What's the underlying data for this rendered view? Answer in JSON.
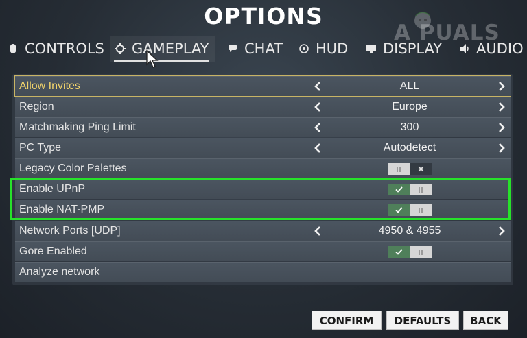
{
  "header": {
    "title": "OPTIONS",
    "watermark": "A  PUALS"
  },
  "tabs": [
    {
      "label": "CONTROLS",
      "icon": "controller-icon",
      "active": false
    },
    {
      "label": "GAMEPLAY",
      "icon": "gear-icon",
      "active": true
    },
    {
      "label": "CHAT",
      "icon": "chat-bubble-icon",
      "active": false
    },
    {
      "label": "HUD",
      "icon": "target-icon",
      "active": false
    },
    {
      "label": "DISPLAY",
      "icon": "monitor-icon",
      "active": false
    },
    {
      "label": "AUDIO",
      "icon": "speaker-icon",
      "active": false
    }
  ],
  "settings": [
    {
      "label": "Allow Invites",
      "type": "select",
      "value": "ALL"
    },
    {
      "label": "Region",
      "type": "select",
      "value": "Europe"
    },
    {
      "label": "Matchmaking Ping Limit",
      "type": "select",
      "value": "300"
    },
    {
      "label": "PC Type",
      "type": "select",
      "value": "Autodetect"
    },
    {
      "label": "Legacy Color Palettes",
      "type": "toggle",
      "on": false
    },
    {
      "label": "Enable UPnP",
      "type": "toggle",
      "on": true
    },
    {
      "label": "Enable NAT-PMP",
      "type": "toggle",
      "on": true
    },
    {
      "label": "Network Ports [UDP]",
      "type": "select",
      "value": "4950 & 4955"
    },
    {
      "label": "Gore Enabled",
      "type": "toggle",
      "on": true
    },
    {
      "label": "Analyze network",
      "type": "action"
    }
  ],
  "buttons": {
    "confirm": "CONFIRM",
    "defaults": "DEFAULTS",
    "back": "BACK"
  },
  "colors": {
    "highlight_frame": "#27e22a",
    "toggle_on": "#4f7f5a",
    "selected_label": "#f1d36b"
  }
}
